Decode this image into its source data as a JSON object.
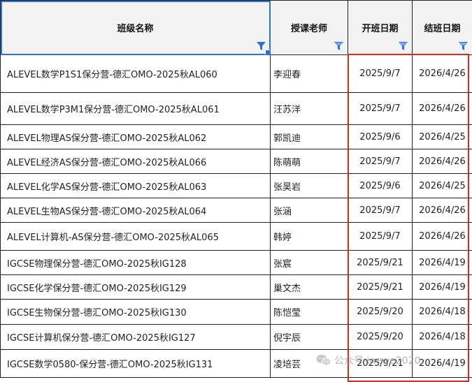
{
  "headers": {
    "class_name": "班级名称",
    "teacher": "授课老师",
    "start_date": "开班日期",
    "end_date": "结班日期"
  },
  "rows": [
    {
      "name": "ALEVEL数学P1S1保分营-德汇OMO-2025秋AL060",
      "teacher": "李迎春",
      "start": "2025/9/7",
      "end": "2026/4/26"
    },
    {
      "name": "ALEVEL数学P3M1保分营-德汇OMO-2025秋AL061",
      "teacher": "汪苏洋",
      "start": "2025/9/7",
      "end": "2026/4/26"
    },
    {
      "name": "ALEVEL物理AS保分营-德汇OMO-2025秋AL062",
      "teacher": "郭凯迪",
      "start": "2025/9/6",
      "end": "2026/4/25"
    },
    {
      "name": "ALEVEL经济AS保分营-德汇OMO-2025秋AL066",
      "teacher": "陈萌萌",
      "start": "2025/9/7",
      "end": "2026/4/26"
    },
    {
      "name": "ALEVEL化学AS保分营-德汇OMO-2025秋AL063",
      "teacher": "张昊岩",
      "start": "2025/9/6",
      "end": "2026/4/25"
    },
    {
      "name": "ALEVEL生物AS保分营-德汇OMO-2025秋AL064",
      "teacher": "张涵",
      "start": "2025/9/7",
      "end": "2026/4/26"
    },
    {
      "name": "ALEVEL计算机-AS保分营-德汇OMO-2025秋AL065",
      "teacher": "韩婷",
      "start": "2025/9/7",
      "end": "2026/4/26"
    },
    {
      "name": "IGCSE物理保分营-德汇OMO-2025秋IG128",
      "teacher": "张宸",
      "start": "2025/9/21",
      "end": "2026/4/19"
    },
    {
      "name": "IGCSE化学保分营-德汇OMO-2025秋IG129",
      "teacher": "巢文杰",
      "start": "2025/9/21",
      "end": "2026/4/19"
    },
    {
      "name": "IGCSE生物保分营-德汇OMO-2025秋IG130",
      "teacher": "陈恺莹",
      "start": "2025/9/20",
      "end": "2026/4/18"
    },
    {
      "name": "IGCSE计算机保分营-德汇OMO-2025秋IG127",
      "teacher": "倪宇辰",
      "start": "2025/9/20",
      "end": "2026/4/18"
    },
    {
      "name": "IGCSE数学0580-保分营-德汇OMO-2025秋IG131",
      "teacher": "凌培芸",
      "start": "2025/9/21",
      "end": "2026/4/19"
    }
  ],
  "watermark": "公众号·inewe2020",
  "colors": {
    "highlight": "#e0281e",
    "selection": "#2b72d6",
    "filter": "#2b72d6",
    "header_bg": "#f2f2f2"
  },
  "icons": {
    "filter": "filter-icon",
    "wechat": "wechat-icon"
  }
}
